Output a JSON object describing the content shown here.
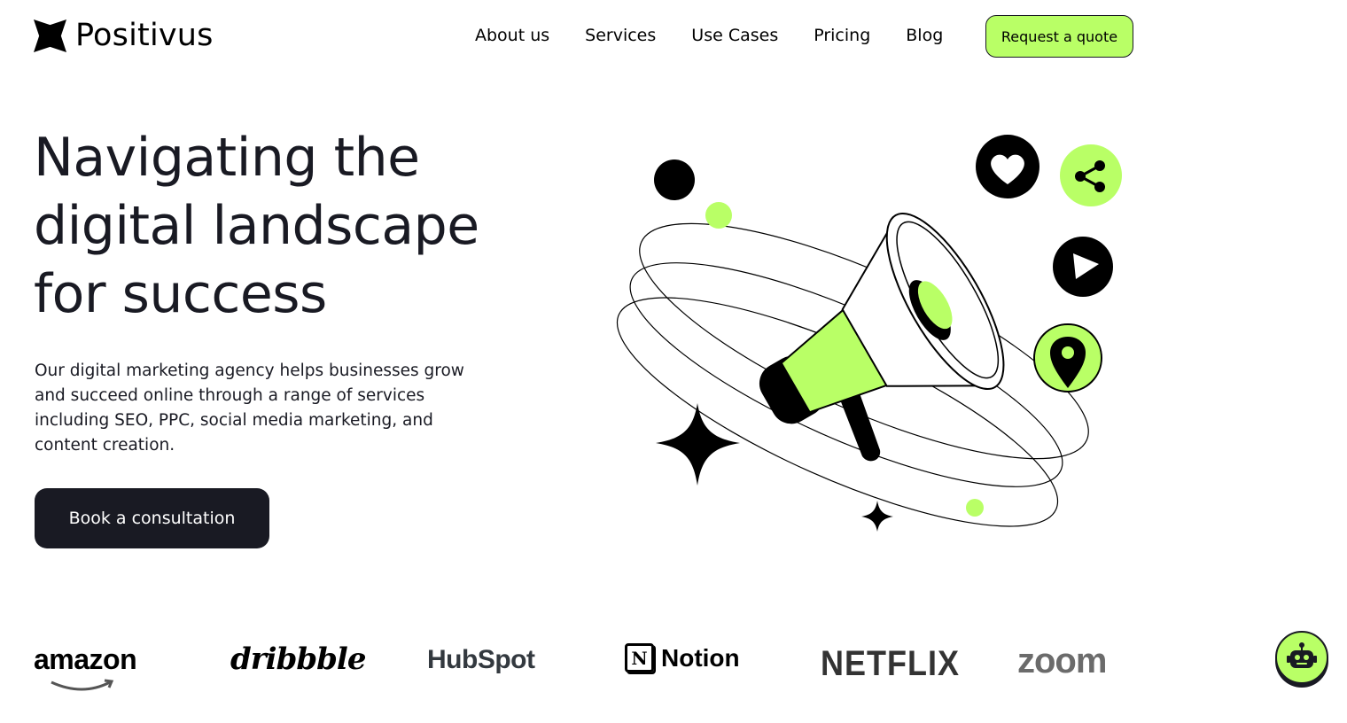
{
  "header": {
    "brand_name": "Positivus",
    "nav": [
      "About us",
      "Services",
      "Use Cases",
      "Pricing",
      "Blog"
    ],
    "cta_label": "Request a quote"
  },
  "hero": {
    "title_lines": [
      "Navigating the",
      "digital landscape",
      "for success"
    ],
    "description": "Our digital marketing agency helps businesses grow and succeed online through a range of services including SEO, PPC, social media marketing, and content creation.",
    "cta_label": "Book a consultation"
  },
  "logos": {
    "amazon": "amazon",
    "dribbble": "dribbble",
    "hubspot": "HubSpot",
    "notion_mark": "N",
    "notion": "Notion",
    "netflix": "NETFLIX",
    "zoom": "zoom"
  },
  "colors": {
    "accent": "#B9FF66",
    "dark": "#191A23",
    "background": "#FFFFFF"
  },
  "icons": [
    "positivus-logo-icon",
    "heart-icon",
    "share-icon",
    "play-icon",
    "location-pin-icon",
    "megaphone-illustration",
    "chatbot-icon"
  ]
}
